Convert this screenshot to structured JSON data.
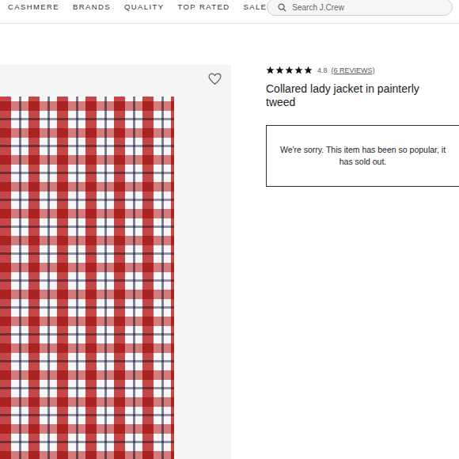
{
  "nav": {
    "links": [
      "CASHMERE",
      "BRANDS",
      "QUALITY",
      "TOP RATED",
      "SALE"
    ]
  },
  "search": {
    "placeholder": "Search J.Crew"
  },
  "product": {
    "stars": 5,
    "rating": "4.8",
    "reviews": "(6 REVIEWS)",
    "title": "Collared lady jacket in painterly tweed",
    "favorited": false,
    "notice": "We're sorry. This item has been so popular, it has sold out."
  }
}
